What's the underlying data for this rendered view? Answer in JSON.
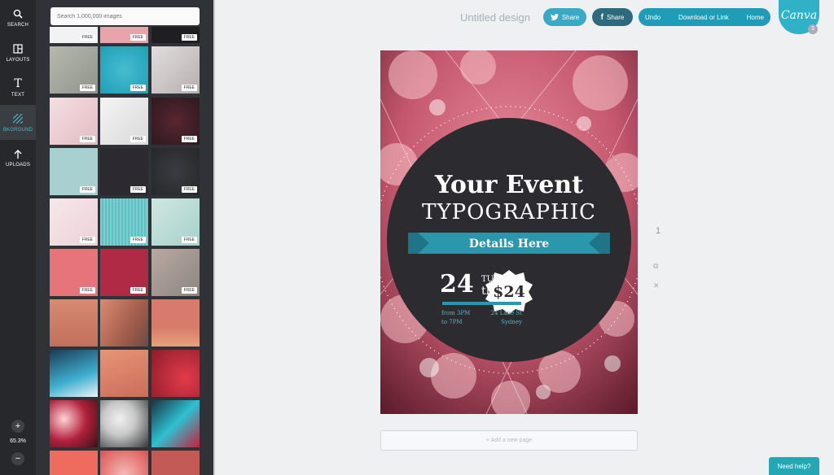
{
  "rail": {
    "items": [
      {
        "label": "SEARCH",
        "icon": "search-icon"
      },
      {
        "label": "LAYOUTS",
        "icon": "layouts-icon"
      },
      {
        "label": "TEXT",
        "icon": "text-icon"
      },
      {
        "label": "BKGROUND",
        "icon": "background-icon"
      },
      {
        "label": "UPLOADS",
        "icon": "uploads-icon"
      }
    ],
    "zoom_in": "+",
    "zoom_level": "65.3%",
    "zoom_out": "−"
  },
  "panel": {
    "search_placeholder": "Search 1,000,000 images",
    "free_label": "FREE"
  },
  "header": {
    "doc_title": "Untitled design",
    "twitter_share": "Share",
    "facebook_share": "Share",
    "undo": "Undo",
    "download": "Download or Link",
    "home": "Home",
    "logo": "Canva",
    "badge": "3"
  },
  "poster": {
    "headline": "Your Event",
    "subheadline": "TYPOGRAPHIC",
    "ribbon": "Details Here",
    "day_number": "24",
    "weekday": "TUESDAY",
    "date_suffix": "th june",
    "time_line1": "from 3PM",
    "time_line2": "to 7PM",
    "address_line1": "24 Lane St",
    "address_line2": "Sydney",
    "price": "$24"
  },
  "page_panel": {
    "page_number": "1",
    "add_page": "+ Add a new page"
  },
  "help": "Need help?",
  "colors": {
    "accent": "#2fb1c8",
    "ribbon": "#2a97ad",
    "circle": "#2c2b30"
  }
}
